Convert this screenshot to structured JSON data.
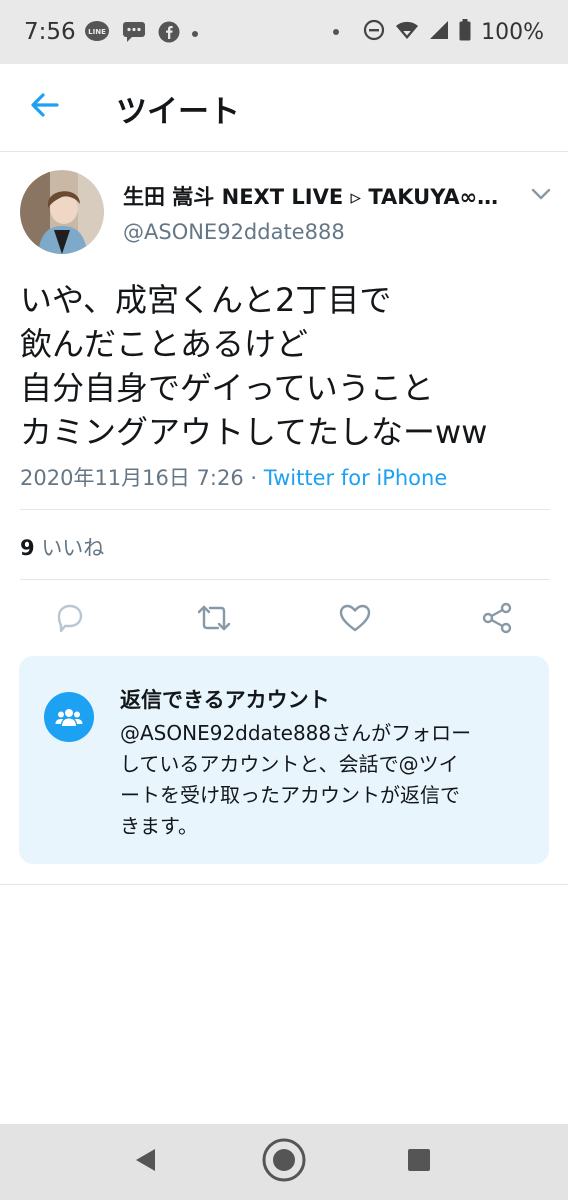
{
  "status_bar": {
    "time": "7:56",
    "battery": "100%",
    "left_icons": [
      "line-icon",
      "message-icon",
      "facebook-icon",
      "dot-icon"
    ],
    "right_icons": [
      "dot-icon",
      "do-not-disturb-icon",
      "wifi-icon",
      "signal-icon",
      "battery-icon"
    ]
  },
  "header": {
    "back_icon": "back-arrow-icon",
    "title": "ツイート"
  },
  "tweet": {
    "display_name": "生田 嵩斗 NEXT LIVE ▹ TAKUYA∞…",
    "handle": "@ASONE92ddate888",
    "text_lines": [
      "いや、成宮くんと2丁目で",
      "飲んだことあるけど",
      "自分自身でゲイっていうこと",
      "カミングアウトしてたしなーww"
    ],
    "date": "2020年11月16日 7:26",
    "separator": " · ",
    "source": "Twitter for iPhone",
    "likes_count": "9",
    "likes_label": "いいね"
  },
  "actions": [
    "reply-icon",
    "retweet-icon",
    "like-icon",
    "share-icon"
  ],
  "reply_card": {
    "title": "返信できるアカウント",
    "body_lines": [
      "@ASONE92ddate888さんがフォロー",
      "しているアカウントと、会話で@ツイ",
      "ートを受け取ったアカウントが返信で",
      "きます。"
    ],
    "icon": "people-icon"
  },
  "nav_bar": [
    "back-triangle-icon",
    "home-circle-icon",
    "recents-square-icon"
  ],
  "colors": {
    "accent": "#1da1f2",
    "secondary_text": "#657786",
    "card_bg": "#e8f5fd"
  }
}
